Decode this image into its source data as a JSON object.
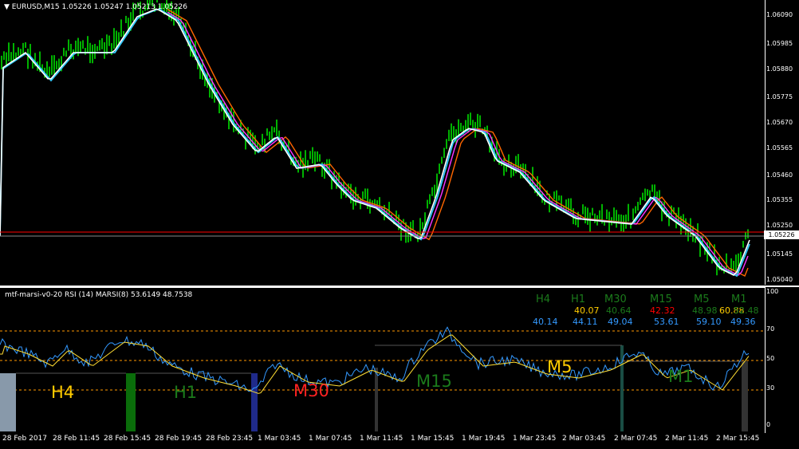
{
  "title": {
    "symbol": "EURUSD,M15",
    "values": "1.05226 1.05247 1.05213 1.05226"
  },
  "price_axis": [
    "1.06090",
    "1.05985",
    "1.05880",
    "1.05775",
    "1.05670",
    "1.05565",
    "1.05460",
    "1.05355",
    "1.05250",
    "1.05145",
    "1.05040"
  ],
  "current_price": "1.05226",
  "indicator": {
    "title": "mtf-marsi-v0-20  RSI (14)  MARSI(8) 53.6149 48.7538",
    "rsi_axis": [
      "100",
      "70",
      "50",
      "30",
      "0"
    ],
    "timeframes": [
      {
        "name": "H4",
        "v1": "",
        "v2": ""
      },
      {
        "name": "H1",
        "v1": "40.07",
        "v2": "40.14"
      },
      {
        "name": "M30",
        "v1": "40.64",
        "v2": "44.11"
      },
      {
        "name": "M15",
        "v1": "42.32",
        "v2": "49.04"
      },
      {
        "name": "M5",
        "v1": "48.98",
        "v2": "53.61"
      },
      {
        "name": "M1",
        "v1": "60.88",
        "v2": "59.10"
      },
      {
        "name": "",
        "v1": "52.48",
        "v2": "49.36"
      }
    ],
    "big_labels": [
      "H4",
      "H1",
      "M30",
      "M15",
      "M5",
      "M1"
    ]
  },
  "time_axis": [
    "28 Feb 2017",
    "28 Feb 11:45",
    "28 Feb 15:45",
    "28 Feb 19:45",
    "28 Feb 23:45",
    "1 Mar 03:45",
    "1 Mar 07:45",
    "1 Mar 11:45",
    "1 Mar 15:45",
    "1 Mar 19:45",
    "1 Mar 23:45",
    "2 Mar 03:45",
    "2 Mar 07:45",
    "2 Mar 11:45",
    "2 Mar 15:45"
  ],
  "colors": {
    "bars": "#00ff00",
    "ma_white": "#ffffff",
    "ma_cyan": "#33ccff",
    "ma_orange": "#ff6600",
    "ma_magenta": "#ff33ff",
    "price_line": "#ff0000"
  }
}
